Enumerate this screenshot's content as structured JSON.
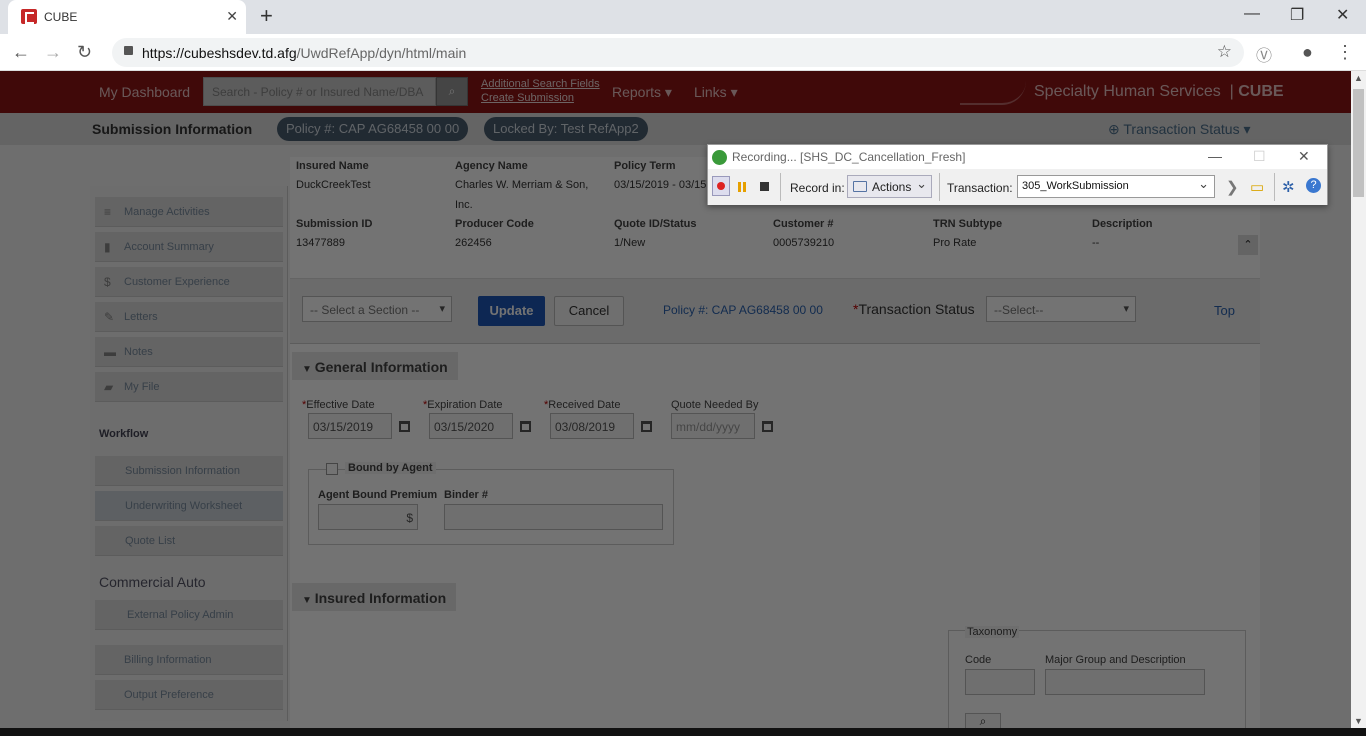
{
  "browser": {
    "tab_title": "CUBE",
    "url_host": "https://cubeshsdev.td.afg",
    "url_path": "/UwdRefApp/dyn/html/main"
  },
  "topnav": {
    "dashboard": "My Dashboard",
    "search_placeholder": "Search - Policy # or Insured Name/DBA",
    "additional_search": "Additional Search Fields",
    "create_submission": "Create Submission",
    "reports": "Reports ▾",
    "links": "Links ▾",
    "brand": "Specialty Human Services",
    "brand_suffix": "CUBE"
  },
  "subheader": {
    "title": "Submission Information",
    "policy_pill": "Policy #: CAP AG68458 00 00",
    "locked_pill": "Locked By: Test RefApp2",
    "transaction_status": "Transaction Status"
  },
  "summary": {
    "labels": [
      "Insured Name",
      "Agency Name",
      "Policy Term",
      "Submission ID",
      "Producer Code",
      "Quote ID/Status",
      "Customer #",
      "TRN Subtype",
      "Description"
    ],
    "insured_name": "DuckCreekTest",
    "agency_name_1": "Charles W. Merriam & Son,",
    "agency_name_2": "Inc.",
    "policy_term": "03/15/2019 - 03/15",
    "submission_id": "13477889",
    "producer_code": "262456",
    "quote_status": "1/New",
    "customer_no": "0005739210",
    "trn_subtype": "Pro Rate",
    "description": "--"
  },
  "toolbar": {
    "section_select": "-- Select a Section --",
    "update": "Update",
    "cancel": "Cancel",
    "policy_link": "Policy #: CAP AG68458 00 00",
    "tx_status_label": "Transaction Status",
    "tx_status_select": "--Select--",
    "top": "Top"
  },
  "general": {
    "heading": "General Information",
    "effective_label": "Effective Date",
    "effective_value": "03/15/2019",
    "expiration_label": "Expiration Date",
    "expiration_value": "03/15/2020",
    "received_label": "Received Date",
    "received_value": "03/08/2019",
    "quote_needed_label": "Quote Needed By",
    "quote_needed_placeholder": "mm/dd/yyyy",
    "bound_by_agent": "Bound by Agent",
    "agent_premium_label": "Agent Bound Premium",
    "premium_symbol": "$",
    "binder_label": "Binder #"
  },
  "insured": {
    "heading": "Insured Information",
    "taxonomy": "Taxonomy",
    "code": "Code",
    "major_group": "Major Group and Description"
  },
  "sidebar": {
    "items": [
      "Manage Activities",
      "Account Summary",
      "Customer Experience",
      "Letters",
      "Notes",
      "My File"
    ],
    "icons": [
      "≡",
      "▮",
      "$",
      "✎",
      "▬",
      "▰"
    ],
    "workflow_head": "Workflow",
    "workflow": [
      "Submission Information",
      "Underwriting Worksheet",
      "Quote List"
    ],
    "commercial_head": "Commercial Auto",
    "external": "External Policy Admin",
    "billing": "Billing Information",
    "output": "Output Preference"
  },
  "recorder": {
    "title": "Recording... [SHS_DC_Cancellation_Fresh]",
    "record_in": "Record in:",
    "actions": "Actions",
    "transaction_label": "Transaction:",
    "transaction_value": "305_WorkSubmission"
  }
}
